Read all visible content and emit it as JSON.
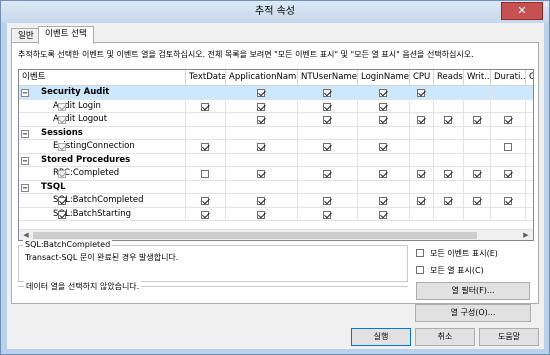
{
  "window": {
    "title": "추적 속성",
    "close_glyph": "✕"
  },
  "tabs": [
    {
      "label": "일반"
    },
    {
      "label": "이벤트 선택"
    }
  ],
  "hint": "추적하도록 선택한 이벤트 및 이벤트 열을 검토하십시오. 전체 목록을 보려면 \"모든 이벤트 표시\" 및 \"모든 열 표시\" 옵션을 선택하십시오.",
  "grid": {
    "columns": [
      "이벤트",
      "TextData",
      "ApplicationName",
      "NTUserName",
      "LoginName",
      "CPU",
      "Reads",
      "Writ...",
      "Durati...",
      "ClientP"
    ],
    "rows": [
      {
        "type": "category",
        "label": "Security Audit",
        "selected": true,
        "cells": [
          null,
          true,
          true,
          true,
          true,
          null,
          null,
          null,
          null
        ]
      },
      {
        "type": "event",
        "label": "Audit Login",
        "cells": [
          true,
          true,
          true,
          true,
          null,
          null,
          null,
          null,
          null
        ]
      },
      {
        "type": "event",
        "label": "Audit Logout",
        "cells": [
          null,
          true,
          true,
          true,
          true,
          true,
          true,
          true,
          null
        ]
      },
      {
        "type": "category",
        "label": "Sessions",
        "cells": [
          null,
          null,
          null,
          null,
          null,
          null,
          null,
          null,
          null
        ]
      },
      {
        "type": "event",
        "label": "ExistingConnection",
        "cells": [
          true,
          true,
          true,
          true,
          null,
          null,
          null,
          false,
          null
        ]
      },
      {
        "type": "category",
        "label": "Stored Procedures",
        "cells": [
          null,
          null,
          null,
          null,
          null,
          null,
          null,
          null,
          null
        ]
      },
      {
        "type": "event",
        "label": "RPC:Completed",
        "cells": [
          false,
          true,
          true,
          true,
          true,
          true,
          true,
          true,
          null
        ]
      },
      {
        "type": "category",
        "label": "TSQL",
        "cells": [
          null,
          null,
          null,
          null,
          null,
          null,
          null,
          null,
          null
        ]
      },
      {
        "type": "event",
        "label": "SQL:BatchCompleted",
        "checked": true,
        "cells": [
          true,
          true,
          true,
          true,
          true,
          true,
          true,
          true,
          null
        ]
      },
      {
        "type": "event",
        "label": "SQL:BatchStarting",
        "checked": true,
        "cells": [
          true,
          true,
          true,
          true,
          null,
          null,
          null,
          null,
          null
        ]
      }
    ]
  },
  "description": {
    "title": "SQL:BatchCompleted",
    "text": "Transact-SQL 문이 완료된 경우 발생합니다."
  },
  "column_info": "데이터 열을 선택하지 않았습니다.",
  "options": {
    "show_all_events": "모든 이벤트 표시(E)",
    "show_all_columns": "모든 열 표시(C)"
  },
  "buttons": {
    "column_filters": "열 필터(F)...",
    "organize_columns": "열 구성(O)...",
    "run": "실행",
    "cancel": "취소",
    "help": "도움말"
  }
}
